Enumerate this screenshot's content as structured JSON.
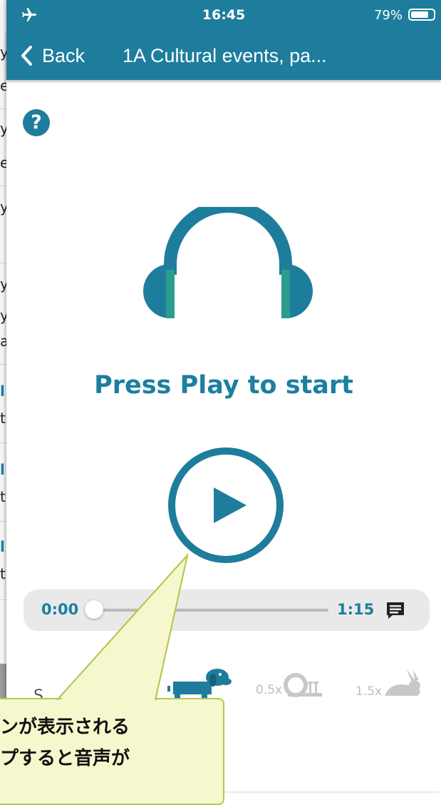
{
  "status_bar": {
    "time": "16:45",
    "battery": "79%"
  },
  "nav": {
    "back_label": "Back",
    "title": "1A Cultural events, pa..."
  },
  "help": {
    "label": "?"
  },
  "player": {
    "prompt": "Press Play to start",
    "current_time": "0:00",
    "duration": "1:15",
    "progress": 0
  },
  "speed": {
    "label_partial": "S",
    "options": [
      {
        "label": "",
        "icon": "dog-icon",
        "selected": true
      },
      {
        "label": "0.5x",
        "icon": "snail-icon",
        "selected": false
      },
      {
        "label": "1.5x",
        "icon": "rabbit-icon",
        "selected": false
      }
    ]
  },
  "callout": {
    "lines": [
      "ンが表示される",
      "プすると音声が"
    ]
  },
  "background_page": {
    "fragments": [
      "y",
      "e",
      "y",
      "e",
      "y",
      "y",
      "y",
      "a",
      "l",
      "t",
      "l",
      "t",
      "l",
      "t"
    ]
  },
  "colors": {
    "brand": "#1e7d9d",
    "accent_teal": "#2a9d8f",
    "callout_bg": "#f7f7cd",
    "callout_border": "#b4c84e"
  }
}
